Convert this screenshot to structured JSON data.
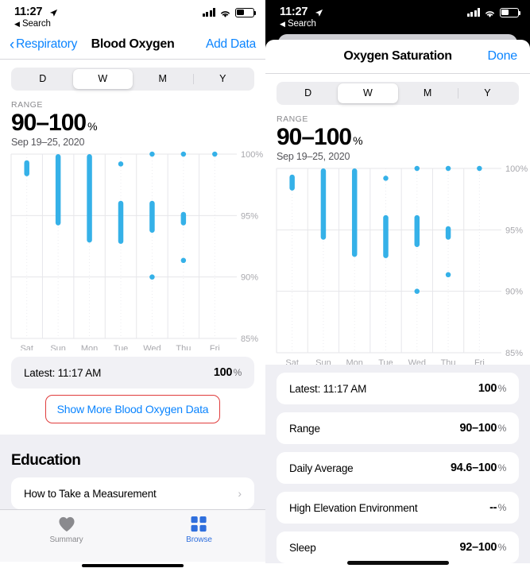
{
  "left": {
    "status": {
      "time": "11:27",
      "back_label": "Search",
      "location_icon": "location-arrow-icon",
      "cellular_icon": "cellular-bars-icon",
      "wifi_icon": "wifi-icon",
      "battery_icon": "battery-icon"
    },
    "nav": {
      "back_label": "Respiratory",
      "title": "Blood Oxygen",
      "action_label": "Add Data"
    },
    "segments": [
      {
        "label": "D",
        "active": false
      },
      {
        "label": "W",
        "active": true
      },
      {
        "label": "M",
        "active": false
      },
      {
        "label": "Y",
        "active": false
      }
    ],
    "range": {
      "label": "RANGE",
      "value": "90–100",
      "unit": "%",
      "date": "Sep 19–25, 2020"
    },
    "latest": {
      "key": "Latest: 11:17 AM",
      "value": "100",
      "unit": "%"
    },
    "show_more_label": "Show More Blood Oxygen Data",
    "education": {
      "title": "Education",
      "item_label": "How to Take a Measurement",
      "chevron": "chevron-right-icon"
    },
    "tabs": [
      {
        "label": "Summary",
        "icon": "heart-icon",
        "active": false
      },
      {
        "label": "Browse",
        "icon": "grid-icon",
        "active": true
      }
    ]
  },
  "right": {
    "status": {
      "time": "11:27",
      "back_label": "Search",
      "location_icon": "location-arrow-icon",
      "cellular_icon": "cellular-bars-icon",
      "wifi_icon": "wifi-icon",
      "battery_icon": "battery-icon"
    },
    "sheet": {
      "title": "Oxygen Saturation",
      "done_label": "Done"
    },
    "segments": [
      {
        "label": "D",
        "active": false
      },
      {
        "label": "W",
        "active": true
      },
      {
        "label": "M",
        "active": false
      },
      {
        "label": "Y",
        "active": false
      }
    ],
    "range": {
      "label": "RANGE",
      "value": "90–100",
      "unit": "%",
      "date": "Sep 19–25, 2020"
    },
    "rows": [
      {
        "key": "Latest: 11:17 AM",
        "value": "100",
        "unit": "%"
      },
      {
        "key": "Range",
        "value": "90–100",
        "unit": "%"
      },
      {
        "key": "Daily Average",
        "value": "94.6–100",
        "unit": "%"
      },
      {
        "key": "High Elevation Environment",
        "value": "--",
        "unit": "%"
      },
      {
        "key": "Sleep",
        "value": "92–100",
        "unit": "%"
      }
    ]
  },
  "colors": {
    "bar": "#35b1e8",
    "accent": "#0a84ff",
    "annotation": "#e03c3c",
    "grid": "#e6e6ea",
    "axis_text": "#a8a8ad"
  },
  "chart_data": {
    "type": "bar",
    "title": "Blood Oxygen — Oxygen Saturation (Weekly)",
    "subtitle": "Sep 19–25, 2020",
    "xlabel": "",
    "ylabel": "%",
    "ylim": [
      85,
      100
    ],
    "yticks": [
      85,
      90,
      95,
      100
    ],
    "ytick_labels": [
      "85%",
      "90%",
      "95%",
      "100%"
    ],
    "grid": true,
    "legend": "none",
    "categories": [
      "Sat",
      "Sun",
      "Mon",
      "Tue",
      "Wed",
      "Thu",
      "Fri"
    ],
    "series": [
      {
        "name": "Oxygen saturation range",
        "type": "range-bars",
        "values": [
          {
            "day": "Sat",
            "segments": [
              [
                98.2,
                99.5
              ]
            ]
          },
          {
            "day": "Sun",
            "segments": [
              [
                94.2,
                100.0
              ]
            ]
          },
          {
            "day": "Mon",
            "segments": [
              [
                92.8,
                100.0
              ]
            ]
          },
          {
            "day": "Tue",
            "segments": [
              [
                92.7,
                96.2
              ],
              [
                99.2,
                99.2
              ]
            ]
          },
          {
            "day": "Wed",
            "segments": [
              [
                93.6,
                96.2
              ],
              [
                89.9,
                90.1
              ],
              [
                100.0,
                100.0
              ]
            ]
          },
          {
            "day": "Thu",
            "segments": [
              [
                94.2,
                95.3
              ],
              [
                91.2,
                91.5
              ],
              [
                100.0,
                100.0
              ]
            ]
          },
          {
            "day": "Fri",
            "segments": [
              [
                100.0,
                100.0
              ]
            ]
          }
        ]
      }
    ],
    "summary": {
      "range_min": 90,
      "range_max": 100,
      "latest": 100,
      "daily_average": "94.6–100",
      "sleep": "92–100"
    }
  }
}
